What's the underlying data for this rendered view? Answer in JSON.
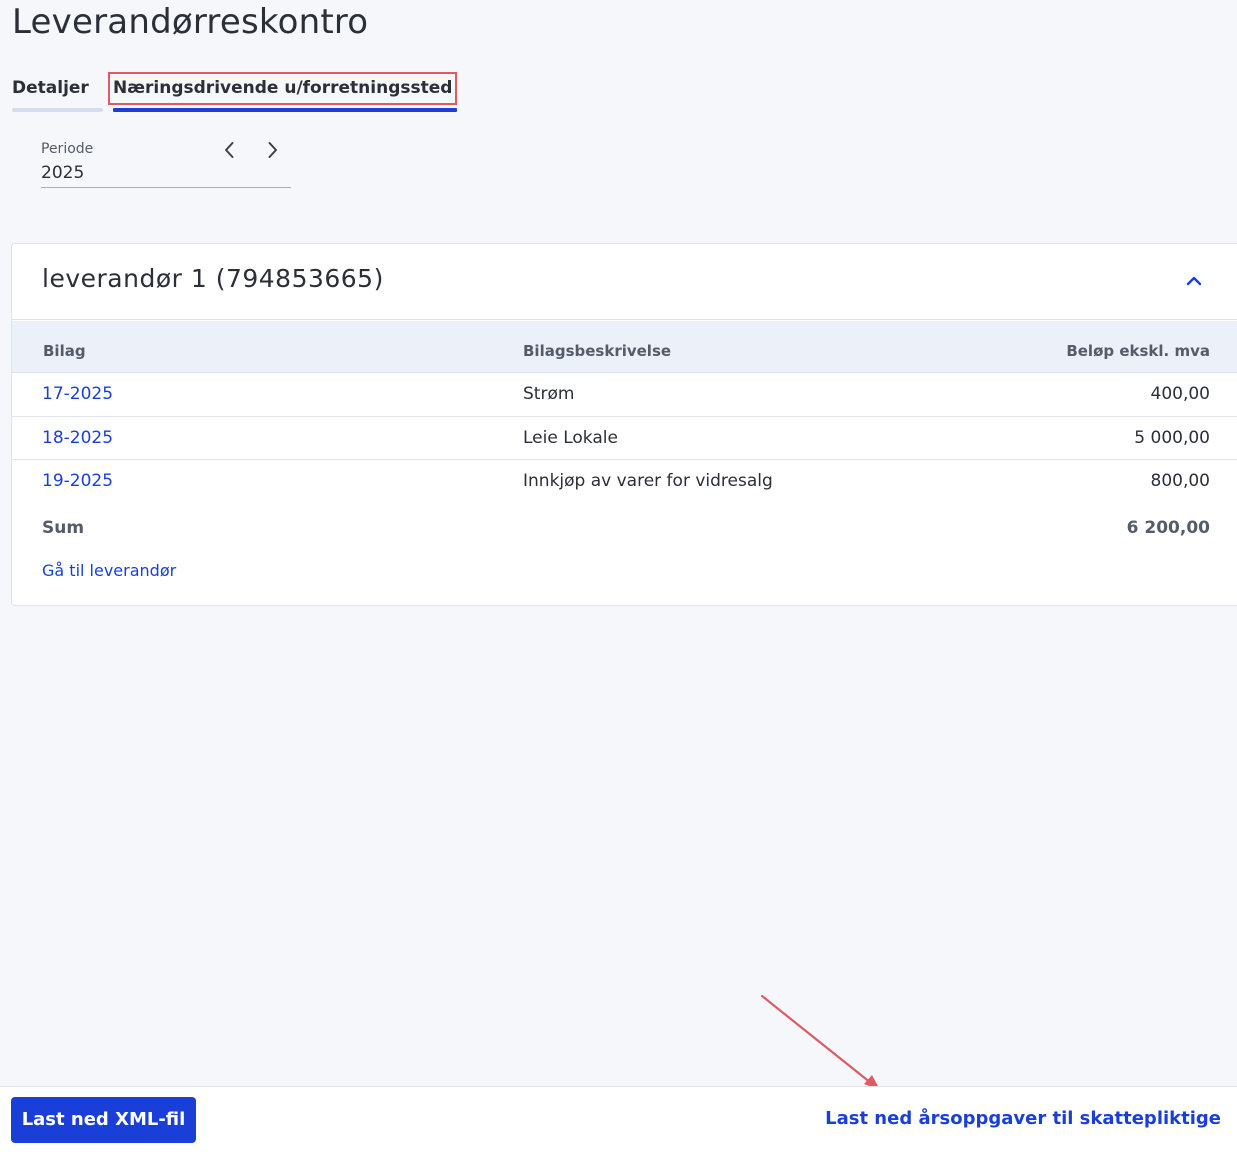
{
  "page": {
    "title": "Leverandørreskontro"
  },
  "tabs": [
    {
      "label": "Detaljer"
    },
    {
      "label": "Næringsdrivende u/forretningssted",
      "active": true
    }
  ],
  "period": {
    "label": "Periode",
    "value": "2025",
    "prev_icon": "chevron-left-icon",
    "next_icon": "chevron-right-icon"
  },
  "supplier": {
    "title": "leverandør 1 (794853665)",
    "collapse_icon": "chevron-up-icon",
    "columns": {
      "bilag": "Bilag",
      "description": "Bilagsbeskrivelse",
      "amount": "Beløp ekskl. mva"
    },
    "rows": [
      {
        "bilag": "17-2025",
        "description": "Strøm",
        "amount": "400,00"
      },
      {
        "bilag": "18-2025",
        "description": "Leie Lokale",
        "amount": "5 000,00"
      },
      {
        "bilag": "19-2025",
        "description": "Innkjøp av varer for vidresalg",
        "amount": "800,00"
      }
    ],
    "sum": {
      "label": "Sum",
      "amount": "6 200,00"
    },
    "goto_link": "Gå til leverandør"
  },
  "footer": {
    "xml_button": "Last ned XML-fil",
    "tax_link": "Last ned årsoppgaver til skattepliktige"
  },
  "colors": {
    "accent": "#1a3fd9",
    "annotation": "#e05a64",
    "background": "#f6f7fb"
  }
}
